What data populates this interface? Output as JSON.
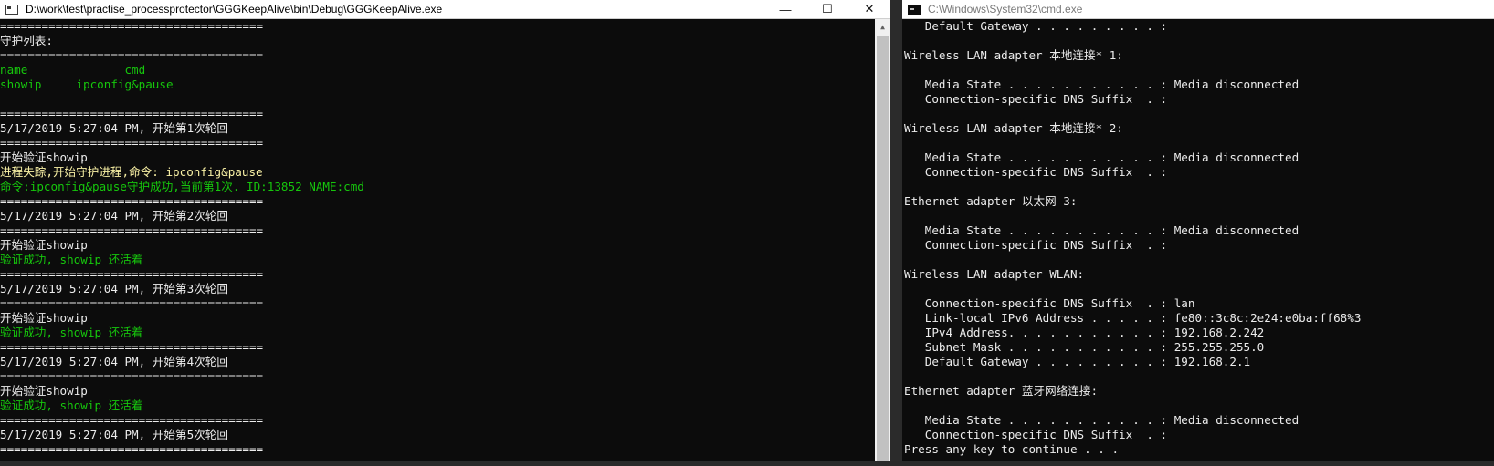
{
  "left_window": {
    "title": "D:\\work\\test\\practise_processprotector\\GGGKeepAlive\\bin\\Debug\\GGGKeepAlive.exe",
    "controls": {
      "minimize": "—",
      "maximize": "☐",
      "close": "✕"
    },
    "lines": [
      {
        "text": "======================================",
        "color": "white"
      },
      {
        "text": "守护列表:",
        "color": "white"
      },
      {
        "text": "======================================",
        "color": "white"
      },
      {
        "text": "name              cmd",
        "color": "green"
      },
      {
        "text": "showip     ipconfig&pause",
        "color": "green"
      },
      {
        "text": "",
        "color": "white"
      },
      {
        "text": "======================================",
        "color": "white"
      },
      {
        "text": "5/17/2019 5:27:04 PM, 开始第1次轮回",
        "color": "white"
      },
      {
        "text": "======================================",
        "color": "white"
      },
      {
        "text": "开始验证showip",
        "color": "white"
      },
      {
        "text": "进程失踪,开始守护进程,命令: ipconfig&pause",
        "color": "yellow"
      },
      {
        "text": "命令:ipconfig&pause守护成功,当前第1次. ID:13852 NAME:cmd",
        "color": "green"
      },
      {
        "text": "======================================",
        "color": "white"
      },
      {
        "text": "5/17/2019 5:27:04 PM, 开始第2次轮回",
        "color": "white"
      },
      {
        "text": "======================================",
        "color": "white"
      },
      {
        "text": "开始验证showip",
        "color": "white"
      },
      {
        "text": "验证成功, showip 还活着",
        "color": "green"
      },
      {
        "text": "======================================",
        "color": "white"
      },
      {
        "text": "5/17/2019 5:27:04 PM, 开始第3次轮回",
        "color": "white"
      },
      {
        "text": "======================================",
        "color": "white"
      },
      {
        "text": "开始验证showip",
        "color": "white"
      },
      {
        "text": "验证成功, showip 还活着",
        "color": "green"
      },
      {
        "text": "======================================",
        "color": "white"
      },
      {
        "text": "5/17/2019 5:27:04 PM, 开始第4次轮回",
        "color": "white"
      },
      {
        "text": "======================================",
        "color": "white"
      },
      {
        "text": "开始验证showip",
        "color": "white"
      },
      {
        "text": "验证成功, showip 还活着",
        "color": "green"
      },
      {
        "text": "======================================",
        "color": "white"
      },
      {
        "text": "5/17/2019 5:27:04 PM, 开始第5次轮回",
        "color": "white"
      },
      {
        "text": "======================================",
        "color": "white"
      }
    ]
  },
  "right_window": {
    "title": "C:\\Windows\\System32\\cmd.exe",
    "lines": [
      {
        "text": "   Default Gateway . . . . . . . . . :",
        "color": "white"
      },
      {
        "text": "",
        "color": "white"
      },
      {
        "text": "Wireless LAN adapter 本地连接* 1:",
        "color": "white"
      },
      {
        "text": "",
        "color": "white"
      },
      {
        "text": "   Media State . . . . . . . . . . . : Media disconnected",
        "color": "white"
      },
      {
        "text": "   Connection-specific DNS Suffix  . :",
        "color": "white"
      },
      {
        "text": "",
        "color": "white"
      },
      {
        "text": "Wireless LAN adapter 本地连接* 2:",
        "color": "white"
      },
      {
        "text": "",
        "color": "white"
      },
      {
        "text": "   Media State . . . . . . . . . . . : Media disconnected",
        "color": "white"
      },
      {
        "text": "   Connection-specific DNS Suffix  . :",
        "color": "white"
      },
      {
        "text": "",
        "color": "white"
      },
      {
        "text": "Ethernet adapter 以太网 3:",
        "color": "white"
      },
      {
        "text": "",
        "color": "white"
      },
      {
        "text": "   Media State . . . . . . . . . . . : Media disconnected",
        "color": "white"
      },
      {
        "text": "   Connection-specific DNS Suffix  . :",
        "color": "white"
      },
      {
        "text": "",
        "color": "white"
      },
      {
        "text": "Wireless LAN adapter WLAN:",
        "color": "white"
      },
      {
        "text": "",
        "color": "white"
      },
      {
        "text": "   Connection-specific DNS Suffix  . : lan",
        "color": "white"
      },
      {
        "text": "   Link-local IPv6 Address . . . . . : fe80::3c8c:2e24:e0ba:ff68%3",
        "color": "white"
      },
      {
        "text": "   IPv4 Address. . . . . . . . . . . : 192.168.2.242",
        "color": "white"
      },
      {
        "text": "   Subnet Mask . . . . . . . . . . . : 255.255.255.0",
        "color": "white"
      },
      {
        "text": "   Default Gateway . . . . . . . . . : 192.168.2.1",
        "color": "white"
      },
      {
        "text": "",
        "color": "white"
      },
      {
        "text": "Ethernet adapter 蓝牙网络连接:",
        "color": "white"
      },
      {
        "text": "",
        "color": "white"
      },
      {
        "text": "   Media State . . . . . . . . . . . : Media disconnected",
        "color": "white"
      },
      {
        "text": "   Connection-specific DNS Suffix  . :",
        "color": "white"
      },
      {
        "text": "Press any key to continue . . .",
        "color": "white"
      }
    ]
  },
  "icons": {
    "left_app_icon": "console-app-icon",
    "right_app_icon": "cmd-icon",
    "scroll_up": "chevron-up-icon"
  }
}
